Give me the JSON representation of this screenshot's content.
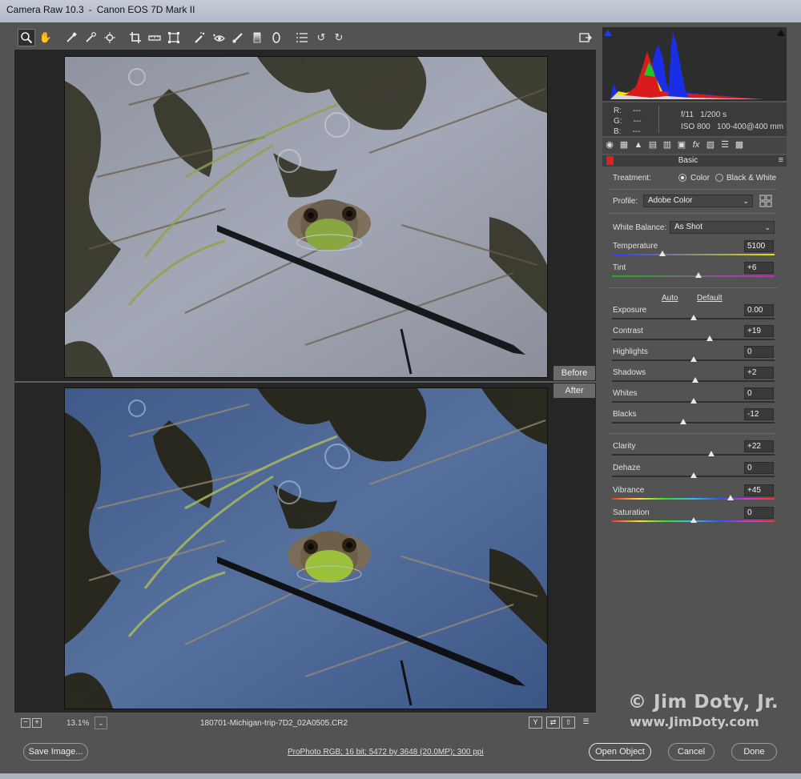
{
  "window": {
    "app": "Camera Raw 10.3",
    "camera": "Canon EOS 7D Mark II"
  },
  "toolbar": {
    "tools": [
      "zoom-tool",
      "hand-tool",
      "white-balance-tool",
      "color-sampler-tool",
      "targeted-adjustment-tool",
      "crop-tool",
      "straighten-tool",
      "transform-tool",
      "spot-removal-tool",
      "red-eye-tool",
      "adjustment-brush-tool",
      "graduated-filter-tool",
      "radial-filter-tool",
      "preferences",
      "rotate-left",
      "rotate-right"
    ],
    "fullscreen_icon": "full-screen-icon"
  },
  "viewer": {
    "before_label": "Before",
    "after_label": "After"
  },
  "status": {
    "zoom_out": "−",
    "zoom_in": "+",
    "zoom": "13.1%",
    "zoom_dropdown": "⌄",
    "filename": "180701-Michigan-trip-7D2_02A0505.CR2"
  },
  "info": {
    "r_label": "R:",
    "g_label": "G:",
    "b_label": "B:",
    "r": "---",
    "g": "---",
    "b": "---",
    "aperture": "f/11",
    "shutter": "1/200 s",
    "iso": "ISO 800",
    "lens": "100-400@400 mm"
  },
  "panel": {
    "section_title": "Basic",
    "treatment_label": "Treatment:",
    "treatment_color": "Color",
    "treatment_bw": "Black & White",
    "profile_label": "Profile:",
    "profile_value": "Adobe Color",
    "wb_label": "White Balance:",
    "wb_value": "As Shot",
    "auto": "Auto",
    "default": "Default",
    "sliders": [
      {
        "label": "Temperature",
        "value": "5100",
        "pos": 0.31
      },
      {
        "label": "Tint",
        "value": "+6",
        "pos": 0.53
      },
      {
        "label": "Exposure",
        "value": "0.00",
        "pos": 0.5
      },
      {
        "label": "Contrast",
        "value": "+19",
        "pos": 0.6
      },
      {
        "label": "Highlights",
        "value": "0",
        "pos": 0.5
      },
      {
        "label": "Shadows",
        "value": "+2",
        "pos": 0.51
      },
      {
        "label": "Whites",
        "value": "0",
        "pos": 0.5
      },
      {
        "label": "Blacks",
        "value": "-12",
        "pos": 0.44
      },
      {
        "label": "Clarity",
        "value": "+22",
        "pos": 0.61
      },
      {
        "label": "Dehaze",
        "value": "0",
        "pos": 0.5
      },
      {
        "label": "Vibrance",
        "value": "+45",
        "pos": 0.73
      },
      {
        "label": "Saturation",
        "value": "0",
        "pos": 0.5
      }
    ]
  },
  "bottom": {
    "save": "Save Image...",
    "workflow": "ProPhoto RGB; 16 bit; 5472 by 3648 (20.0MP); 300 ppi",
    "open": "Open Object",
    "cancel": "Cancel",
    "done": "Done"
  },
  "watermark": {
    "line1": "© Jim Doty, Jr.",
    "line2": "www.JimDoty.com"
  }
}
